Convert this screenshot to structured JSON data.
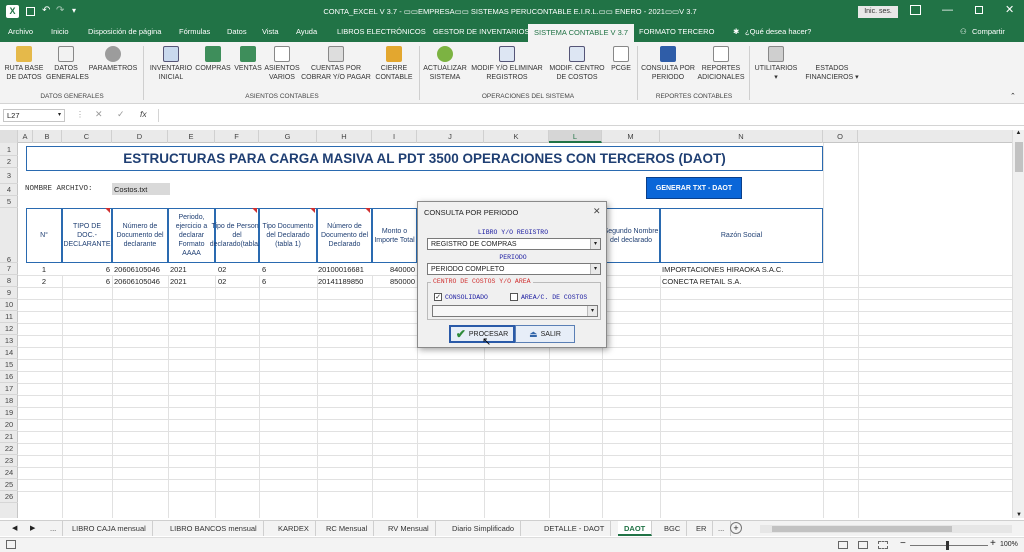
{
  "window": {
    "title": "CONTA_EXCEL V 3.7 - ▭▭EMPRESA▭▭ SISTEMAS PERUCONTABLE E.I.R.L.▭▭ ENERO - 2021▭▭V 3.7",
    "signin_label": "Inic. ses."
  },
  "menu": {
    "items": [
      "Archivo",
      "Inicio",
      "Disposición de página",
      "Fórmulas",
      "Datos",
      "Vista",
      "Ayuda",
      "LIBROS ELECTRÓNICOS",
      "GESTOR DE INVENTARIOS",
      "SISTEMA CONTABLE V 3.7",
      "FORMATO TERCERO"
    ],
    "tell_me": "¿Qué desea hacer?",
    "share": "Compartir"
  },
  "ribbon": {
    "groups": [
      {
        "label": "DATOS GENERALES",
        "buttons": [
          "RUTA BASE DE DATOS",
          "DATOS GENERALES",
          "PARAMETROS"
        ]
      },
      {
        "label": "ASIENTOS CONTABLES",
        "buttons": [
          "INVENTARIO INICIAL",
          "COMPRAS",
          "VENTAS",
          "ASIENTOS VARIOS",
          "CUENTAS POR COBRAR Y/O PAGAR",
          "CIERRE CONTABLE"
        ]
      },
      {
        "label": "OPERACIONES DEL SISTEMA",
        "buttons": [
          "ACTUALIZAR SISTEMA",
          "MODIF Y/O ELIMINAR REGISTROS",
          "MODIF. CENTRO DE COSTOS",
          "PCGE"
        ]
      },
      {
        "label": "REPORTES CONTABLES",
        "buttons": [
          "CONSULTA POR PERIODO",
          "REPORTES ADICIONALES"
        ]
      },
      {
        "label": "",
        "buttons": [
          "UTILITARIOS",
          "ESTADOS FINANCIEROS"
        ]
      }
    ]
  },
  "formula_bar": {
    "name_box": "L27",
    "fx": "fx",
    "value": ""
  },
  "columns": [
    "A",
    "B",
    "C",
    "D",
    "E",
    "F",
    "G",
    "H",
    "I",
    "J",
    "K",
    "L",
    "M",
    "N",
    "O"
  ],
  "rows": [
    "1",
    "2",
    "3",
    "4",
    "5",
    "6",
    "7",
    "8",
    "9",
    "10",
    "11",
    "12",
    "13",
    "14",
    "15",
    "16",
    "17",
    "18",
    "19",
    "20",
    "21",
    "22",
    "23",
    "24",
    "25",
    "26"
  ],
  "sheet": {
    "title": "ESTRUCTURAS PARA CARGA MASIVA  AL PDT 3500 OPERACIONES CON TERCEROS (DAOT)",
    "file_label": "NOMBRE ARCHIVO:",
    "file_name": "Costos.txt",
    "generate_button": "GENERAR TXT - DAOT",
    "headers": [
      "N°",
      "TIPO DE DOC.- DECLARANTE",
      "Número de Documento del declarante",
      "Periodo, ejercicio a declarar Formato AAAA",
      "Tipo de Persona del declarado(tabla2)",
      "Tipo Documento del Declarado (tabla 1)",
      "Número de Documento del Declarado",
      "Monto o Importe Total",
      "Segundo Nombre del declarado",
      "Razón Social"
    ],
    "data_rows": [
      {
        "n": "1",
        "tipo_doc": "6",
        "num_doc": "20606105046",
        "periodo": "2021",
        "tipo_persona": "02",
        "tipo_doc_declarado": "6",
        "num_declarado": "20100016681",
        "monto": "840000",
        "razon": "IMPORTACIONES HIRAOKA S.A.C."
      },
      {
        "n": "2",
        "tipo_doc": "6",
        "num_doc": "20606105046",
        "periodo": "2021",
        "tipo_persona": "02",
        "tipo_doc_declarado": "6",
        "num_declarado": "20141189850",
        "monto": "850000",
        "razon": "CONECTA RETAIL S.A."
      }
    ]
  },
  "dialog": {
    "title": "CONSULTA POR PERIODO",
    "close": "✕",
    "libro_label": "LIBRO Y/O REGISTRO",
    "libro_value": "REGISTRO DE COMPRAS",
    "periodo_label": "PERIODO",
    "periodo_value": "PERIODO COMPLETO",
    "centro_label": "CENTRO DE COSTOS Y/O AREA",
    "consolidado_label": "CONSOLIDADO",
    "area_label": "AREA/C. DE COSTOS",
    "centro_value": "",
    "procesar_label": "PROCESAR",
    "salir_label": "SALIR"
  },
  "tabs": [
    "...",
    "LIBRO CAJA mensual",
    "LIBRO BANCOS mensual",
    "KARDEX",
    "RC Mensual",
    "RV Mensual",
    "Diario Simplificado",
    "DETALLE - DAOT",
    "DAOT",
    "BGC",
    "ER",
    "..."
  ],
  "active_tab": "DAOT",
  "status": {
    "zoom": "100%"
  },
  "colors": {
    "excel_green": "#217346",
    "title_blue": "#1f3f73",
    "button_blue": "#0a66d8"
  }
}
